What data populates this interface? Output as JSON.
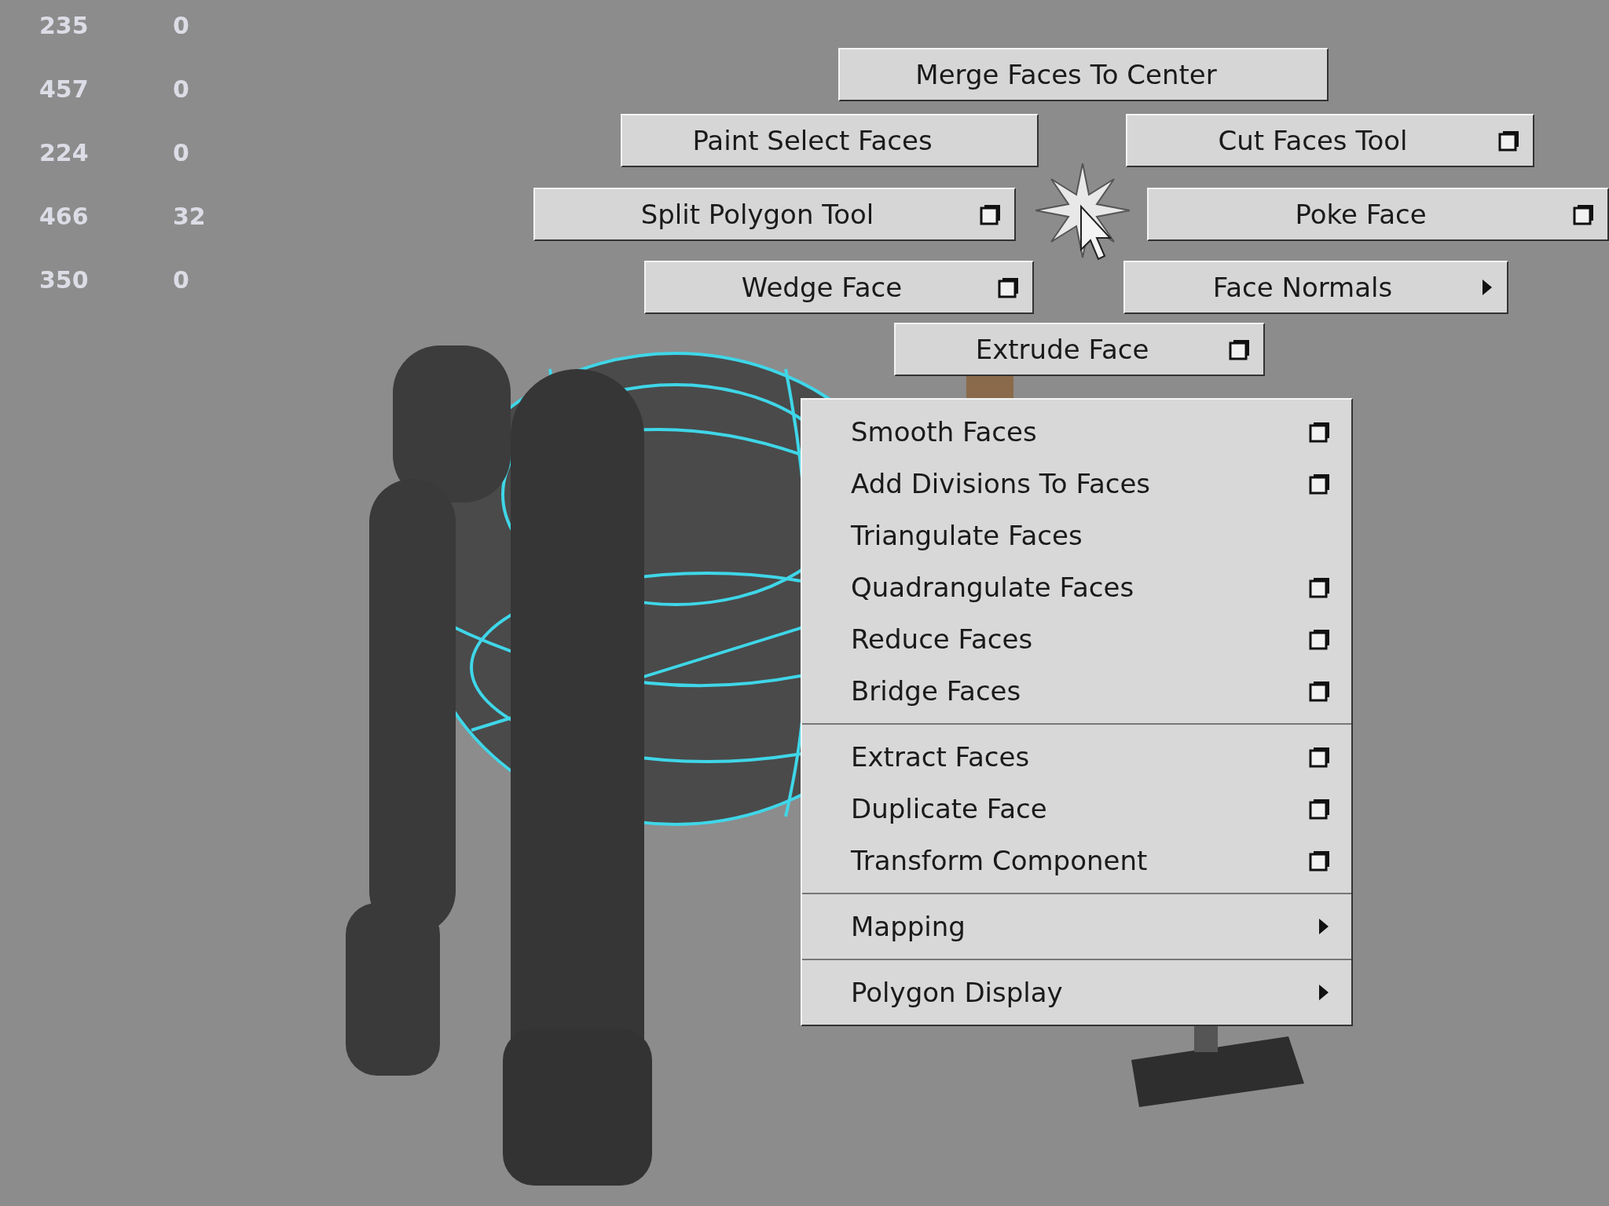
{
  "stats": [
    {
      "count": "235",
      "value": "0"
    },
    {
      "count": "457",
      "value": "0"
    },
    {
      "count": "224",
      "value": "0"
    },
    {
      "count": "466",
      "value": "32"
    },
    {
      "count": "350",
      "value": "0"
    }
  ],
  "marking_menu": [
    {
      "label": "Merge Faces To Center",
      "kind": "plain"
    },
    {
      "label": "Paint Select Faces",
      "kind": "plain"
    },
    {
      "label": "Cut Faces Tool",
      "kind": "option"
    },
    {
      "label": "Split Polygon Tool",
      "kind": "option"
    },
    {
      "label": "Poke Face",
      "kind": "option"
    },
    {
      "label": "Wedge Face",
      "kind": "option"
    },
    {
      "label": "Face Normals",
      "kind": "submenu"
    },
    {
      "label": "Extrude Face",
      "kind": "option"
    }
  ],
  "context_menu": [
    [
      {
        "label": "Smooth Faces",
        "kind": "option"
      },
      {
        "label": "Add Divisions To Faces",
        "kind": "option"
      },
      {
        "label": "Triangulate Faces",
        "kind": "plain"
      },
      {
        "label": "Quadrangulate Faces",
        "kind": "option"
      },
      {
        "label": "Reduce Faces",
        "kind": "option"
      },
      {
        "label": "Bridge Faces",
        "kind": "option"
      }
    ],
    [
      {
        "label": "Extract Faces",
        "kind": "option"
      },
      {
        "label": "Duplicate Face",
        "kind": "option"
      },
      {
        "label": "Transform Component",
        "kind": "option"
      }
    ],
    [
      {
        "label": "Mapping",
        "kind": "submenu"
      }
    ],
    [
      {
        "label": "Polygon Display",
        "kind": "submenu"
      }
    ]
  ]
}
